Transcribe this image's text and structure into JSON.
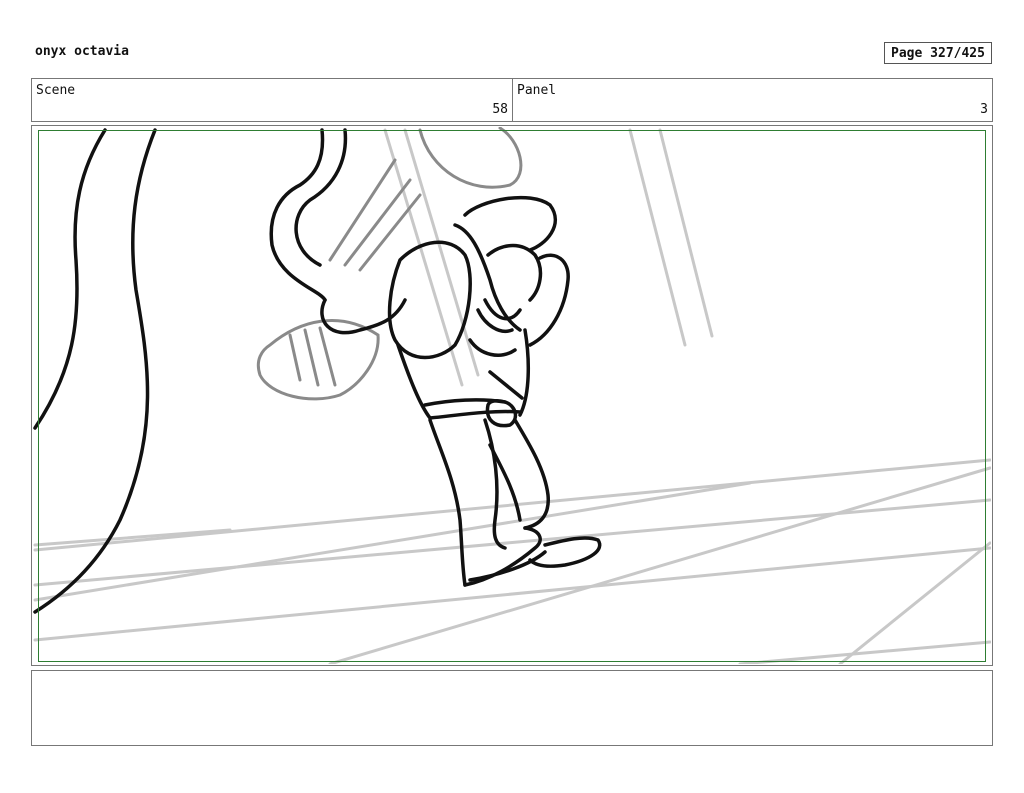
{
  "header": {
    "author": "onyx octavia",
    "page_label": "Page 327/425"
  },
  "info": {
    "scene_label": "Scene",
    "scene_value": "58",
    "panel_label": "Panel",
    "panel_value": "3"
  },
  "frame": {
    "safe_area_color": "#2e7d32",
    "sketch_color": "#111111",
    "guide_color": "#c8c8c8"
  },
  "notes": {
    "text": ""
  }
}
